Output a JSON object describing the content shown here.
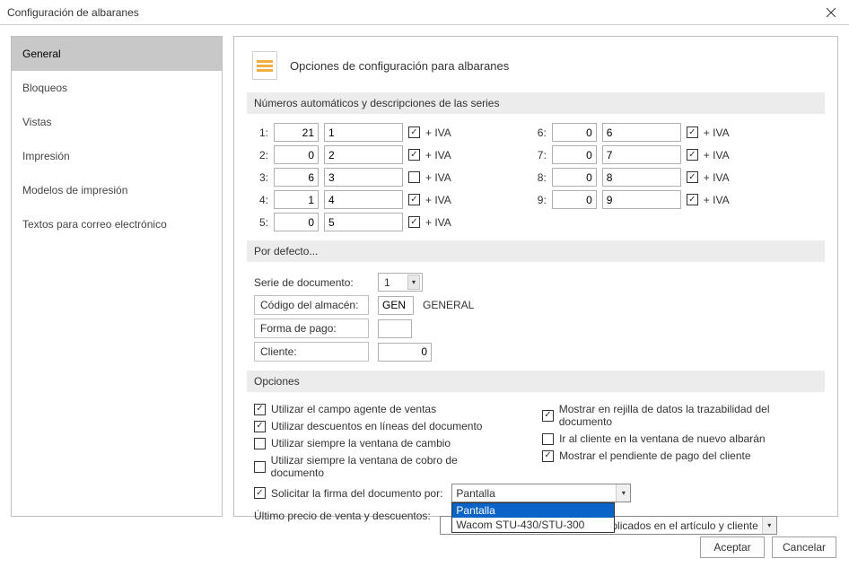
{
  "window": {
    "title": "Configuración de albaranes"
  },
  "sidebar": {
    "items": [
      {
        "label": "General",
        "active": true
      },
      {
        "label": "Bloqueos"
      },
      {
        "label": "Vistas"
      },
      {
        "label": "Impresión"
      },
      {
        "label": "Modelos de impresión"
      },
      {
        "label": "Textos para correo electrónico"
      }
    ]
  },
  "main": {
    "title": "Opciones de configuración para albaranes",
    "series_head": "Números automáticos y descripciones de las series",
    "iva_suffix": "+ IVA",
    "series": [
      {
        "idx": "1:",
        "num": "21",
        "desc": "1",
        "iva": true
      },
      {
        "idx": "2:",
        "num": "0",
        "desc": "2",
        "iva": true
      },
      {
        "idx": "3:",
        "num": "6",
        "desc": "3",
        "iva": false
      },
      {
        "idx": "4:",
        "num": "1",
        "desc": "4",
        "iva": true
      },
      {
        "idx": "5:",
        "num": "0",
        "desc": "5",
        "iva": true
      },
      {
        "idx": "6:",
        "num": "0",
        "desc": "6",
        "iva": true
      },
      {
        "idx": "7:",
        "num": "0",
        "desc": "7",
        "iva": true
      },
      {
        "idx": "8:",
        "num": "0",
        "desc": "8",
        "iva": true
      },
      {
        "idx": "9:",
        "num": "0",
        "desc": "9",
        "iva": true
      }
    ],
    "defaults_head": "Por defecto...",
    "defaults": {
      "serie_label": "Serie de documento:",
      "serie_value": "1",
      "almacen_label": "Código del almacén:",
      "almacen_code": "GEN",
      "almacen_desc": "GENERAL",
      "pago_label": "Forma de pago:",
      "pago_value": "",
      "cliente_label": "Cliente:",
      "cliente_value": "0"
    },
    "options_head": "Opciones",
    "options_left": [
      {
        "label": "Utilizar el campo agente de ventas",
        "checked": true
      },
      {
        "label": "Utilizar descuentos en líneas del documento",
        "checked": true
      },
      {
        "label": "Utilizar siempre la ventana de cambio",
        "checked": false
      },
      {
        "label": "Utilizar siempre la ventana de cobro de documento",
        "checked": false
      }
    ],
    "options_right": [
      {
        "label": "Mostrar en rejilla de datos la trazabilidad del documento",
        "checked": true
      },
      {
        "label": "Ir al cliente en la ventana de nuevo albarán",
        "checked": false
      },
      {
        "label": "Mostrar el pendiente de pago del cliente",
        "checked": true
      }
    ],
    "firma": {
      "label": "Solicitar la firma del documento por:",
      "checked": true,
      "value": "Pantalla",
      "options": [
        "Pantalla",
        "Wacom STU-430/STU-300"
      ]
    },
    "precio": {
      "label": "Último precio de venta y descuentos:",
      "value_suffix": "os aplicados en el artículo y cliente"
    }
  },
  "footer": {
    "ok": "Aceptar",
    "cancel": "Cancelar"
  }
}
